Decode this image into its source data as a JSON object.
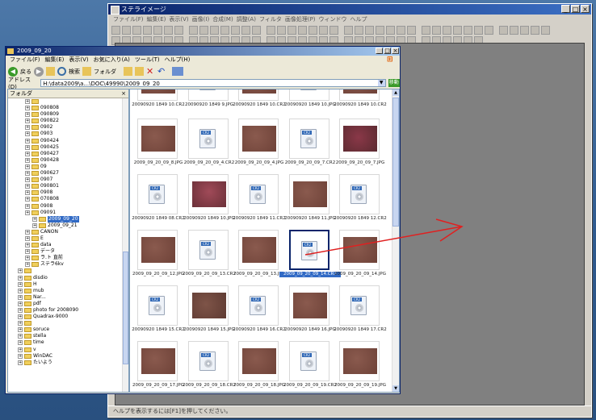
{
  "app": {
    "title": "ステライメージ",
    "menu": [
      "ファイル(F)",
      "編集(E)",
      "表示(V)",
      "画像(I)",
      "合成(M)",
      "調整(A)",
      "フィルタ",
      "画像処理(P)",
      "ウィンドウ",
      "ヘルプ"
    ],
    "status_text": "ヘルプを表示するには[F1]を押してください。"
  },
  "explorer": {
    "title": "2009_09_20",
    "menu": [
      "ファイル(F)",
      "編集(E)",
      "表示(V)",
      "お気に入り(A)",
      "ツール(T)",
      "ヘルプ(H)"
    ],
    "toolbar": {
      "back": "戻る",
      "search": "検索",
      "folders": "フォルダ"
    },
    "address_label": "アドレス(D)",
    "address_value": "H:\\data2009\\a...\\DOC\\49990\\2009_09_20",
    "go": "移動",
    "folders_title": "フォルダ",
    "folders_close": "×",
    "tree": [
      {
        "label": "",
        "indent": 1
      },
      {
        "label": "090808",
        "indent": 1
      },
      {
        "label": "090809",
        "indent": 1
      },
      {
        "label": "090822",
        "indent": 1
      },
      {
        "label": "0902",
        "indent": 1
      },
      {
        "label": "0903",
        "indent": 1
      },
      {
        "label": "090424",
        "indent": 1
      },
      {
        "label": "090425",
        "indent": 1
      },
      {
        "label": "090427",
        "indent": 1
      },
      {
        "label": "090428",
        "indent": 1
      },
      {
        "label": "09",
        "indent": 1
      },
      {
        "label": "090627",
        "indent": 1
      },
      {
        "label": "0907",
        "indent": 1
      },
      {
        "label": "090801",
        "indent": 1
      },
      {
        "label": "0908",
        "indent": 1
      },
      {
        "label": "070808",
        "indent": 1
      },
      {
        "label": "0908",
        "indent": 1
      },
      {
        "label": "09091",
        "indent": 1
      },
      {
        "label": "2009_09_20",
        "indent": 2,
        "selected": true
      },
      {
        "label": "2009_09_21",
        "indent": 2
      },
      {
        "label": "CANON",
        "indent": 1
      },
      {
        "label": "E",
        "indent": 1
      },
      {
        "label": "data",
        "indent": 1
      },
      {
        "label": "データ",
        "indent": 1
      },
      {
        "label": "ラ.ト 直前",
        "indent": 1
      },
      {
        "label": "ステラ6kv",
        "indent": 1
      },
      {
        "label": "",
        "indent": 0
      },
      {
        "label": "disdio",
        "indent": 0
      },
      {
        "label": "H",
        "indent": 0
      },
      {
        "label": "mub",
        "indent": 0
      },
      {
        "label": "Nar...",
        "indent": 0
      },
      {
        "label": "pdf",
        "indent": 0
      },
      {
        "label": "photo for 2008090",
        "indent": 0
      },
      {
        "label": "Quadrax-9000",
        "indent": 0
      },
      {
        "label": "",
        "indent": 0
      },
      {
        "label": "soruce",
        "indent": 0
      },
      {
        "label": "stella",
        "indent": 0
      },
      {
        "label": "time",
        "indent": 0
      },
      {
        "label": "v",
        "indent": 0
      },
      {
        "label": "WinDAC",
        "indent": 0
      },
      {
        "label": "たいよう",
        "indent": 0
      }
    ],
    "thumbnails": [
      {
        "name": "20090920 1849 10.CR2",
        "type": "photo-a"
      },
      {
        "name": "20090920 1849 9.JPG",
        "type": "cr2"
      },
      {
        "name": "20090920 1849 10.CR2",
        "type": "photo-a"
      },
      {
        "name": "20090920 1849 10.JPG",
        "type": "cr2"
      },
      {
        "name": "20090920 1849 10.CR2",
        "type": "photo-a"
      },
      {
        "name": "2009_09_20_09_8.JPG",
        "type": "photo-a"
      },
      {
        "name": "2009_09_20_09_4.CR2",
        "type": "cr2"
      },
      {
        "name": "2009_09_20_09_4.JPG",
        "type": "photo-a"
      },
      {
        "name": "2009_09_20_09_7.CR2",
        "type": "cr2"
      },
      {
        "name": "2009_09_20_09_7.JPG",
        "type": "photo-b"
      },
      {
        "name": "20090920 1849 08.CR2",
        "type": "cr2"
      },
      {
        "name": "20090920 1849 10.JPG",
        "type": "photo-c"
      },
      {
        "name": "20090920 1849 11.CR2",
        "type": "cr2"
      },
      {
        "name": "20090920 1849 11.JPG",
        "type": "photo-a"
      },
      {
        "name": "20090920 1849 12.CR2",
        "type": "cr2"
      },
      {
        "name": "2009_09_20_09_12.JPG",
        "type": "photo-a"
      },
      {
        "name": "2009_09_20_09_13.CR2",
        "type": "cr2"
      },
      {
        "name": "2009_09_20_09_13.JPG",
        "type": "photo-a"
      },
      {
        "name": "2009_09_20_09_14.CR2",
        "type": "cr2",
        "selected": true
      },
      {
        "name": "2009_09_20_09_14.JPG",
        "type": "photo-a"
      },
      {
        "name": "20090920 1849 15.CR2",
        "type": "cr2"
      },
      {
        "name": "20090920 1849 15.JPG",
        "type": "photo-d"
      },
      {
        "name": "20090920 1849 16.CR2",
        "type": "cr2"
      },
      {
        "name": "20090920 1849 16.JPG",
        "type": "photo-a"
      },
      {
        "name": "20090920 1849 17.CR2",
        "type": "cr2"
      },
      {
        "name": "2009_09_20_09_17.JPG",
        "type": "photo-a"
      },
      {
        "name": "2009_09_20_09_18.CR2",
        "type": "cr2"
      },
      {
        "name": "2009_09_20_09_18.JPG",
        "type": "photo-a"
      },
      {
        "name": "2009_09_20_09_19.CR2",
        "type": "cr2"
      },
      {
        "name": "2009_09_20_09_19.JPG",
        "type": "photo-a"
      }
    ]
  },
  "colors": {
    "arrow": "#e02020",
    "selection": "#316ac5"
  }
}
